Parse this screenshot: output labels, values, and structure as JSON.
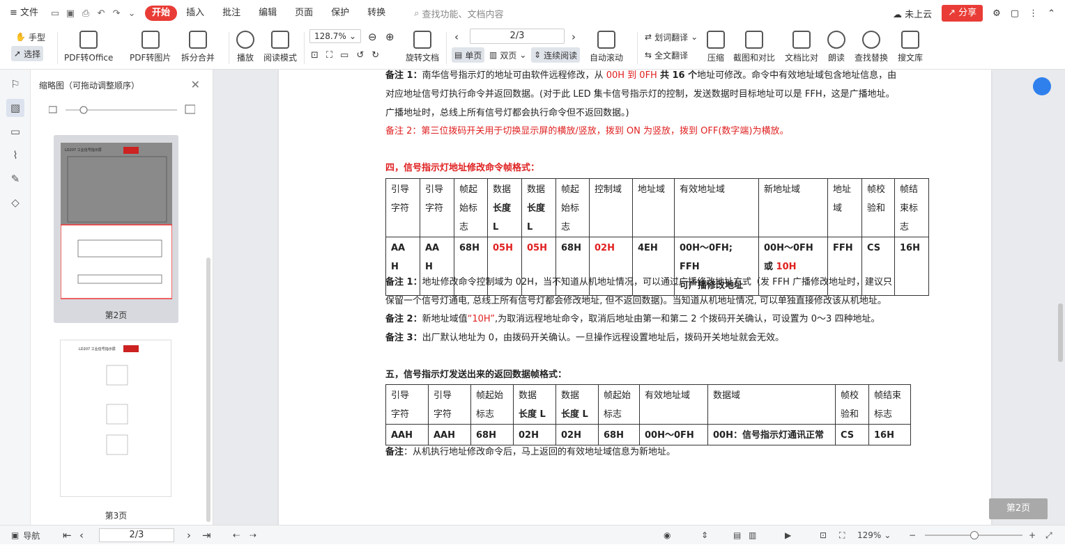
{
  "menubar": {
    "file": "文件",
    "tabs": [
      "开始",
      "插入",
      "批注",
      "编辑",
      "页面",
      "保护",
      "转换"
    ],
    "search": "查找功能、文档内容",
    "cloud": "未上云",
    "share": "分享"
  },
  "toolbar": {
    "hand": "手型",
    "select": "选择",
    "pdf_office": "PDF转Office",
    "pdf_image": "PDF转图片",
    "split_merge": "拆分合并",
    "play": "播放",
    "read_mode": "阅读模式",
    "zoom": "128.7%",
    "rotate": "旋转文档",
    "page": "2/3",
    "single": "单页",
    "double": "双页",
    "continuous": "连续阅读",
    "autoscroll": "自动滚动",
    "word_translate": "划词翻译",
    "full_translate": "全文翻译",
    "compress": "压缩",
    "screenshot": "截图和对比",
    "compare": "文档比对",
    "read_aloud": "朗读",
    "find_replace": "查找替换",
    "library": "搜文库"
  },
  "panel": {
    "title": "缩略图（可拖动调整顺序）",
    "thumbs": [
      {
        "label": "第2页"
      },
      {
        "label": "第3页"
      }
    ]
  },
  "doc": {
    "note1a": "备注 1：",
    "note1b": "南华信号指示灯的地址可由软件远程修改，从 ",
    "note1c": "00H 到 0FH ",
    "note1d": "共 16 个",
    "note1e": "地址可修改。命令中有效地址域包含地址信息，由",
    "line2": "对应地址信号灯执行命令并返回数据。(对于此 LED 集卡信号指示灯的控制，发送数据时目标地址可以是 FFH，这是广播地址。",
    "line3": "广播地址时，总线上所有信号灯都会执行命令但不返回数据。)",
    "note2": "备注 2：第三位拨码开关用于切换显示屏的横放/竖放，拨到 ON 为竖放，拨到 OFF(数字端)为横放。",
    "sec4": "四，信号指示灯地址修改命令帧格式：",
    "t1_headers": [
      [
        "引导",
        "字符"
      ],
      [
        "引导",
        "字符"
      ],
      [
        "帧起",
        "始标",
        "志"
      ],
      [
        "数据",
        "长度",
        "L"
      ],
      [
        "数据",
        "长度",
        "L"
      ],
      [
        "帧起",
        "始标",
        "志"
      ],
      [
        "控制域"
      ],
      [
        "地址域"
      ],
      [
        "有效地址域"
      ],
      [
        "新地址域"
      ],
      [
        "地址",
        "域"
      ],
      [
        "帧校",
        "验和"
      ],
      [
        "帧结",
        "束标",
        "志"
      ]
    ],
    "t1_values": [
      [
        "AA",
        "H"
      ],
      [
        "AA",
        "H"
      ],
      [
        "68H"
      ],
      [
        "05H"
      ],
      [
        "05H"
      ],
      [
        "68H"
      ],
      [
        "02H"
      ],
      [
        "4EH"
      ],
      [
        "00H～0FH; FFH",
        "可广播修改地址"
      ],
      [
        "00H～0FH",
        "或 ",
        "10H"
      ],
      [
        "FFH"
      ],
      [
        "CS"
      ],
      [
        "16H"
      ]
    ],
    "s4n1a": "备注 1：",
    "s4n1b": "地址修改命令控制域为 02H，当不知道从机地址情况，可以通过广播修改地址方式（发 FFH 广播修改地址时，建议只",
    "s4n1c": "保留一个信号灯通电, 总线上所有信号灯都会修改地址, 但不返回数据)。当知道从机地址情况, 可以单独直接修改该从机地址。",
    "s4n2a": "备注 2：",
    "s4n2b": "新地址域值",
    "s4n2c": "“10H”",
    "s4n2d": ",为取消远程地址命令，取消后地址由第一和第二 2 个拨码开关确认，可设置为 0～3 四种地址。",
    "s4n3a": "备注 3：",
    "s4n3b": "出厂默认地址为 0，由拨码开关确认。一旦操作远程设置地址后，拨码开关地址就会无效。",
    "sec5": "五，信号指示灯发送出来的返回数据帧格式：",
    "t2_headers": [
      [
        "引导",
        "字符"
      ],
      [
        "引导",
        "字符"
      ],
      [
        "帧起始",
        "标志"
      ],
      [
        "数据",
        "长度 L"
      ],
      [
        "数据",
        "长度 L"
      ],
      [
        "帧起始",
        "标志"
      ],
      [
        "有效地址域"
      ],
      [
        "数据域"
      ],
      [
        "帧校",
        "验和"
      ],
      [
        "帧结束",
        "标志"
      ]
    ],
    "t2_values": [
      "AAH",
      "AAH",
      "68H",
      "02H",
      "02H",
      "68H",
      "00H～0FH",
      "00H：信号指示灯通讯正常",
      "CS",
      "16H"
    ],
    "s5n_a": "备注",
    "s5n_b": "：从机执行地址修改命令后，马上返回的有效地址域信息为新地址。"
  },
  "pagetag": "第2页",
  "status": {
    "nav": "导航",
    "page": "2/3",
    "zoom": "129%"
  }
}
